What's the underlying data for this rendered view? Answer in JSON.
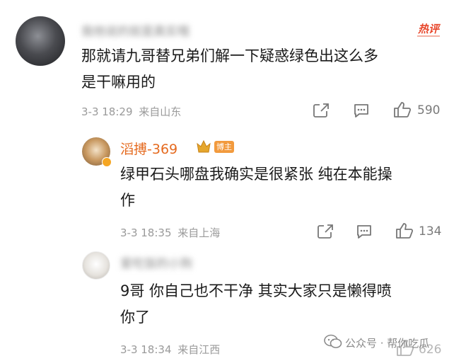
{
  "comment1": {
    "username": "我他说的就是真实哦",
    "hot_badge": "热评",
    "text_line1": "那就请九哥替兄弟们解一下疑惑绿色出这么多",
    "text_line2": "是干嘛用的",
    "time": "3-3 18:29",
    "location": "来自山东",
    "likes": "590"
  },
  "reply1": {
    "username": "滔搏-369",
    "host_badge": "博主",
    "text_line1": "绿甲石头哪盘我确实是很紧张 纯在本能操",
    "text_line2": "作",
    "time": "3-3 18:35",
    "location": "来自上海",
    "likes": "134"
  },
  "reply2": {
    "username": "爱吃饭的小狗",
    "text_line1": "9哥 你自己也不干净 其实大家只是懒得喷",
    "text_line2": "你了",
    "time": "3-3 18:34",
    "location": "来自江西",
    "likes": "626"
  },
  "watermark": {
    "text": "公众号 · 帮你吃瓜"
  },
  "colors": {
    "hot": "#e8472c",
    "host_badge": "#f29a3d",
    "vip_crown": "#e5a62c"
  }
}
